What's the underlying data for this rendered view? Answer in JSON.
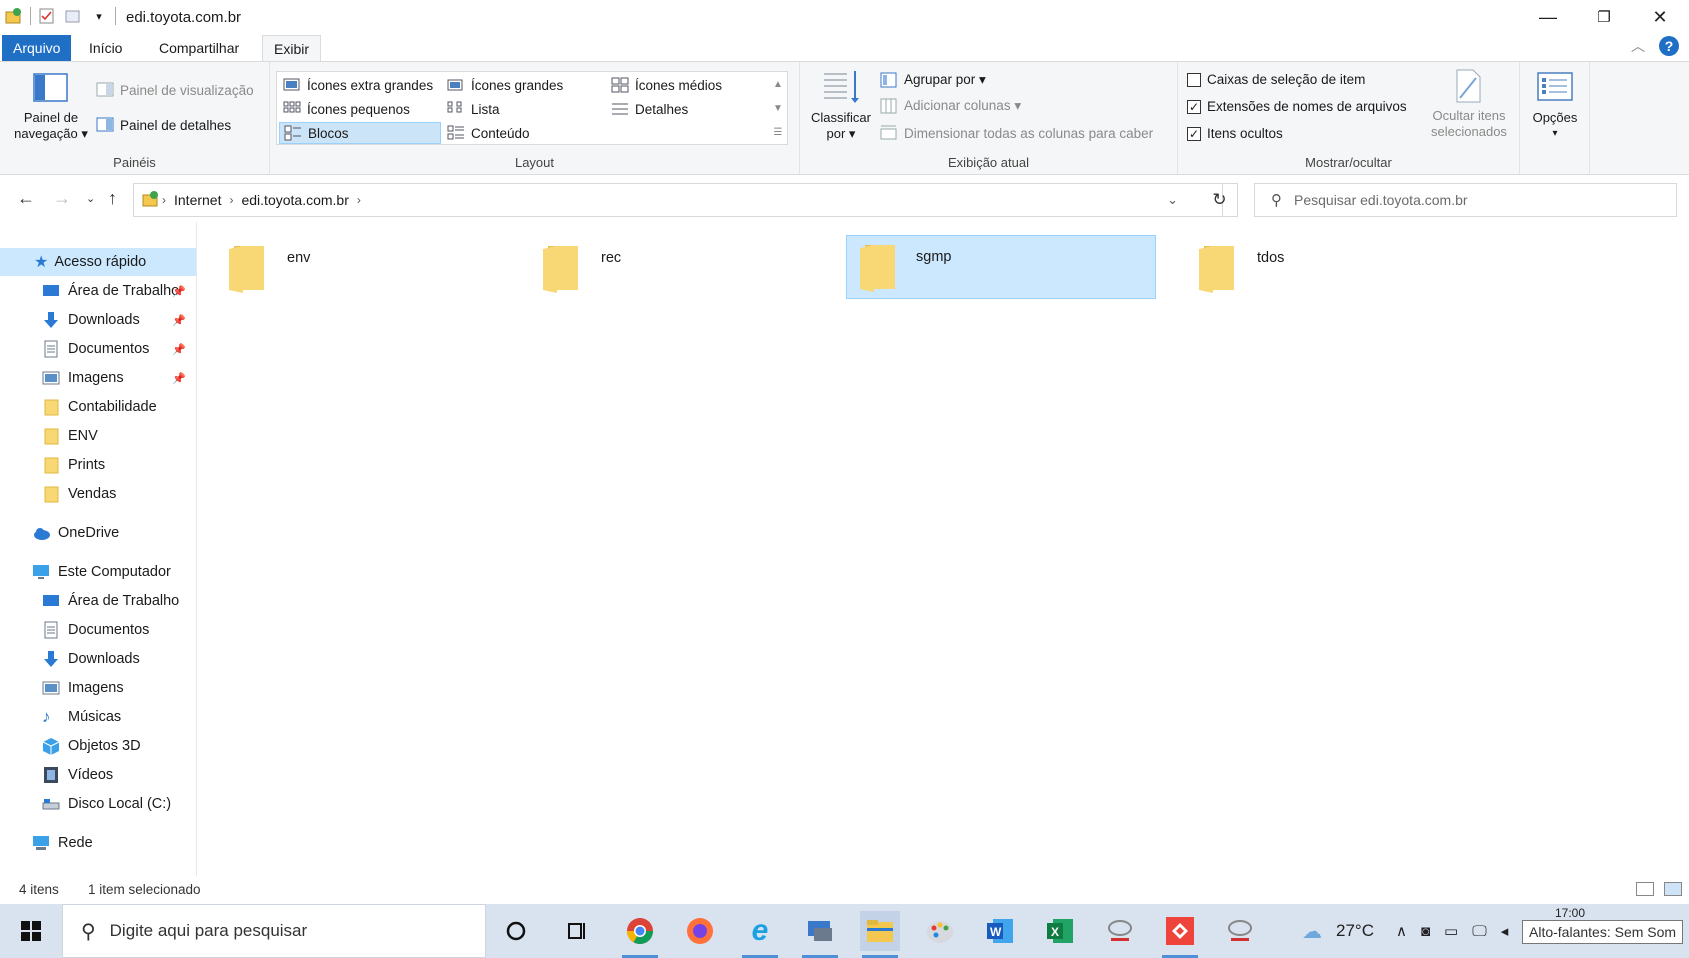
{
  "window": {
    "title": "edi.toyota.com.br",
    "controls": {
      "minimize": "—",
      "restore": "❐",
      "close": "✕"
    }
  },
  "ribbon": {
    "tabs": [
      "Arquivo",
      "Início",
      "Compartilhar",
      "Exibir"
    ],
    "active_tab": "Exibir",
    "panes_group": {
      "label": "Painéis",
      "nav_pane_line1": "Painel de",
      "nav_pane_line2": "navegação ▾",
      "preview_pane": "Painel de visualização",
      "details_pane": "Painel de detalhes"
    },
    "layout_group": {
      "label": "Layout",
      "items": [
        "Ícones extra grandes",
        "Ícones grandes",
        "Ícones médios",
        "Ícones pequenos",
        "Lista",
        "Detalhes",
        "Blocos",
        "Conteúdo"
      ],
      "selected": "Blocos"
    },
    "current_view_group": {
      "label": "Exibição atual",
      "sort_by_line1": "Classificar",
      "sort_by_line2": "por ▾",
      "group_by": "Agrupar por ▾",
      "add_columns": "Adicionar colunas ▾",
      "size_columns": "Dimensionar todas as colunas para caber"
    },
    "show_hide_group": {
      "label": "Mostrar/ocultar",
      "item_checkboxes": {
        "label": "Caixas de seleção de item",
        "checked": false
      },
      "file_extensions": {
        "label": "Extensões de nomes de arquivos",
        "checked": true
      },
      "hidden_items": {
        "label": "Itens ocultos",
        "checked": true
      },
      "hide_selected_line1": "Ocultar itens",
      "hide_selected_line2": "selecionados"
    },
    "options": {
      "label": "Opções",
      "arrow": "▾"
    }
  },
  "address": {
    "crumbs": [
      "Internet",
      "edi.toyota.com.br"
    ],
    "search_placeholder": "Pesquisar edi.toyota.com.br"
  },
  "sidebar": {
    "quick_access": "Acesso rápido",
    "quick_items": [
      {
        "label": "Área de Trabalho",
        "icon": "desktop-icon",
        "pinned": true
      },
      {
        "label": "Downloads",
        "icon": "download-icon",
        "pinned": true
      },
      {
        "label": "Documentos",
        "icon": "document-icon",
        "pinned": true
      },
      {
        "label": "Imagens",
        "icon": "pictures-icon",
        "pinned": true
      },
      {
        "label": "Contabilidade",
        "icon": "folder-icon",
        "pinned": false
      },
      {
        "label": "ENV",
        "icon": "folder-icon",
        "pinned": false
      },
      {
        "label": "Prints",
        "icon": "folder-icon",
        "pinned": false
      },
      {
        "label": "Vendas",
        "icon": "folder-icon",
        "pinned": false
      }
    ],
    "onedrive": "OneDrive",
    "this_pc": "Este Computador",
    "pc_items": [
      {
        "label": "Área de Trabalho",
        "icon": "desktop-icon"
      },
      {
        "label": "Documentos",
        "icon": "document-icon"
      },
      {
        "label": "Downloads",
        "icon": "download-icon"
      },
      {
        "label": "Imagens",
        "icon": "pictures-icon"
      },
      {
        "label": "Músicas",
        "icon": "music-icon"
      },
      {
        "label": "Objetos 3D",
        "icon": "3d-objects-icon"
      },
      {
        "label": "Vídeos",
        "icon": "video-icon"
      },
      {
        "label": "Disco Local (C:)",
        "icon": "drive-icon"
      }
    ],
    "network": "Rede"
  },
  "content": {
    "folders": [
      {
        "name": "env",
        "selected": false
      },
      {
        "name": "rec",
        "selected": false
      },
      {
        "name": "sgmp",
        "selected": true
      },
      {
        "name": "tdos",
        "selected": false
      }
    ]
  },
  "status": {
    "item_count": "4 itens",
    "selection": "1 item selecionado"
  },
  "taskbar": {
    "search_placeholder": "Digite aqui para pesquisar",
    "apps": [
      "cortana-icon",
      "task-view-icon",
      "chrome-icon",
      "firefox-icon",
      "internet-explorer-icon",
      "remote-desktop-icon",
      "file-explorer-icon",
      "paint-icon",
      "word-icon",
      "excel-icon",
      "toyota-icon",
      "anydesk-icon",
      "toyota-icon"
    ],
    "temperature": "27°C",
    "clock": "17:00",
    "tooltip": "Alto-falantes: Sem Som"
  },
  "colors": {
    "accent": "#1f6fc5",
    "selection": "#cce8ff",
    "folder": "#f8d775",
    "taskbar": "#d9e3f0"
  }
}
